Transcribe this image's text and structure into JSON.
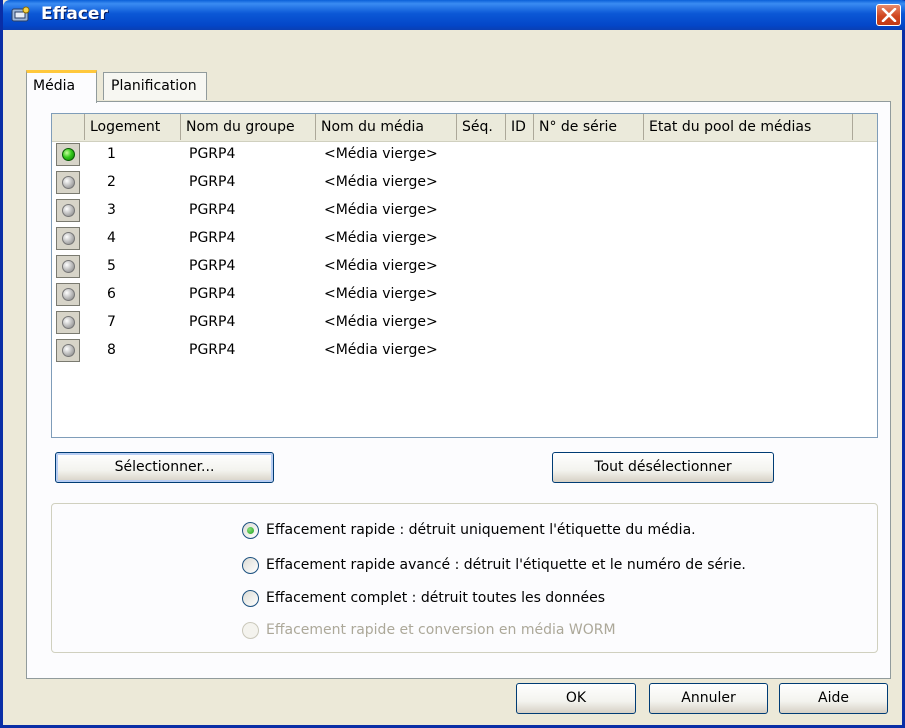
{
  "window": {
    "title": "Effacer"
  },
  "tabs": [
    {
      "label": "Média"
    },
    {
      "label": "Planification"
    }
  ],
  "table": {
    "columns": [
      "Logement",
      "Nom du groupe",
      "Nom du média",
      "Séq.",
      "ID",
      "N° de série",
      "Etat du pool de médias"
    ],
    "rows": [
      {
        "status": "on",
        "slot": "1",
        "group": "PGRP4",
        "media": "<Média vierge>"
      },
      {
        "status": "off",
        "slot": "2",
        "group": "PGRP4",
        "media": "<Média vierge>"
      },
      {
        "status": "off",
        "slot": "3",
        "group": "PGRP4",
        "media": "<Média vierge>"
      },
      {
        "status": "off",
        "slot": "4",
        "group": "PGRP4",
        "media": "<Média vierge>"
      },
      {
        "status": "off",
        "slot": "5",
        "group": "PGRP4",
        "media": "<Média vierge>"
      },
      {
        "status": "off",
        "slot": "6",
        "group": "PGRP4",
        "media": "<Média vierge>"
      },
      {
        "status": "off",
        "slot": "7",
        "group": "PGRP4",
        "media": "<Média vierge>"
      },
      {
        "status": "off",
        "slot": "8",
        "group": "PGRP4",
        "media": "<Média vierge>"
      }
    ]
  },
  "buttons": {
    "select": "Sélectionner...",
    "deselect_all": "Tout désélectionner",
    "ok": "OK",
    "cancel": "Annuler",
    "help": "Aide"
  },
  "erase_options": [
    {
      "label": "Effacement rapide : détruit uniquement l'étiquette du média.",
      "checked": true,
      "disabled": false
    },
    {
      "label": "Effacement rapide avancé : détruit l'étiquette et le numéro de série.",
      "checked": false,
      "disabled": false
    },
    {
      "label": "Effacement complet : détruit toutes les données",
      "checked": false,
      "disabled": false
    },
    {
      "label": "Effacement rapide et conversion en média WORM",
      "checked": false,
      "disabled": true
    }
  ],
  "colors": {
    "titlebar": "#0b58d6",
    "dialog_bg": "#ece9d8",
    "status_on": "#34c91b",
    "status_off": "#bdbdbd"
  }
}
